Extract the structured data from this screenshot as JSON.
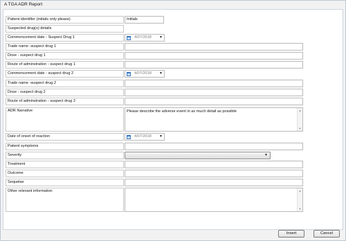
{
  "window": {
    "title": "A TGA ADR Report"
  },
  "form": {
    "patient_identifier": {
      "label": "Patient identifier (initials only please)",
      "value": "Initials"
    },
    "suspected_drugs": {
      "label": "Suspected drug(s) details"
    },
    "commencement_date_1": {
      "label": "Commencement date - Suspect Drug 1",
      "value": "4/07/2018"
    },
    "trade_name_1": {
      "label": "Trade name -suspect drug 1",
      "value": ""
    },
    "dose_1": {
      "label": "Dose - suspect drug 1",
      "value": ""
    },
    "route_1": {
      "label": "Route of adminstration - suspect drug 1",
      "value": ""
    },
    "commencement_date_2": {
      "label": "Commencement date - suspect drug 2",
      "value": "4/07/2018"
    },
    "trade_name_2": {
      "label": "Trade name -suspect drug 2",
      "value": ""
    },
    "dose_2": {
      "label": "Dose - suspect drug 2",
      "value": ""
    },
    "route_2": {
      "label": "Route of adminstration - suspect drug 2",
      "value": ""
    },
    "adr_narrative": {
      "label": "ADR Narrative",
      "value": "Please describe the adverse event in as much detail as possible"
    },
    "onset_date": {
      "label": "Date of onset of reaction",
      "value": "4/07/2018"
    },
    "patient_symptoms": {
      "label": "Patient symptoms",
      "value": ""
    },
    "severity": {
      "label": "Severity",
      "value": ""
    },
    "treatment": {
      "label": "Treatment",
      "value": ""
    },
    "outcome": {
      "label": "Outcome",
      "value": ""
    },
    "sequelae": {
      "label": "Sequelae",
      "value": ""
    },
    "other_info": {
      "label": "Other relevant information",
      "value": ""
    }
  },
  "buttons": {
    "insert": "Insert",
    "cancel": "Cancel"
  },
  "icons": {
    "calendar": "calendar-icon",
    "dropdown": "chevron-down-icon",
    "scroll_up": "scroll-up-icon",
    "scroll_down": "scroll-down-icon"
  }
}
